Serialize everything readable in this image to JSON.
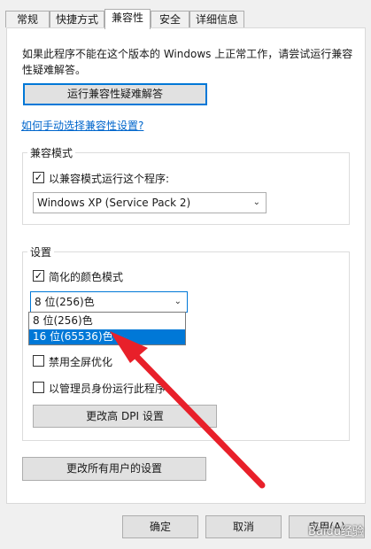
{
  "tabs": [
    {
      "label": "常规"
    },
    {
      "label": "快捷方式"
    },
    {
      "label": "兼容性"
    },
    {
      "label": "安全"
    },
    {
      "label": "详细信息"
    }
  ],
  "intro_text": "如果此程序不能在这个版本的 Windows 上正常工作，请尝试运行兼容性疑难解答。",
  "troubleshooter_button": "运行兼容性疑难解答",
  "manual_link": "如何手动选择兼容性设置?",
  "compat_mode": {
    "legend": "兼容模式",
    "checkbox_label": "以兼容模式运行这个程序:",
    "checked": true,
    "selected_os": "Windows XP (Service Pack 2)"
  },
  "settings": {
    "legend": "设置",
    "reduced_color_label": "简化的颜色模式",
    "reduced_color_checked": true,
    "color_selected": "8 位(256)色",
    "color_options": [
      "8 位(256)色",
      "16 位(65536)色"
    ],
    "highlighted_option": "16 位(65536)色",
    "disable_fullscreen_label": "禁用全屏优化",
    "disable_fullscreen_checked": false,
    "run_as_admin_label": "以管理员身份运行此程序",
    "run_as_admin_checked": false,
    "dpi_button": "更改高 DPI 设置"
  },
  "all_users_button": "更改所有用户的设置",
  "footer": {
    "ok": "确定",
    "cancel": "取消",
    "apply": "应用(A)"
  },
  "watermark": "Baidu经验",
  "check_mark": "✓",
  "chevron": "⌄",
  "annotation_color": "#e8202a"
}
